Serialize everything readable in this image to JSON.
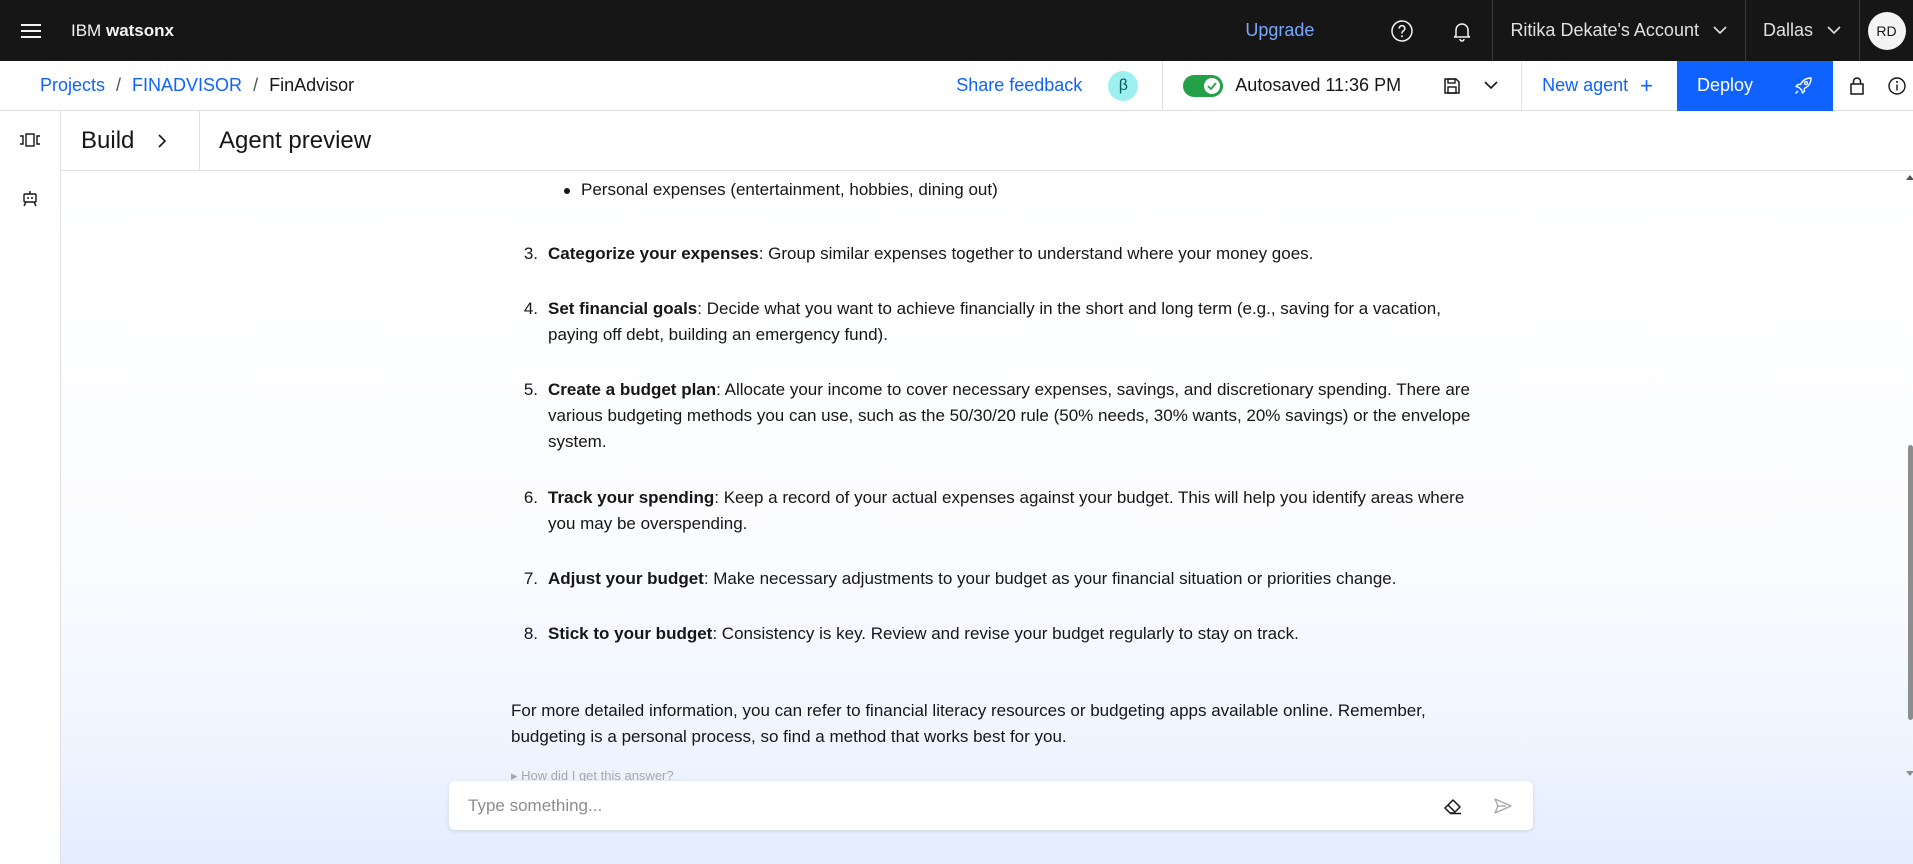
{
  "header": {
    "brand_prefix": "IBM",
    "brand_name": "watsonx",
    "upgrade_label": "Upgrade",
    "account_label": "Ritika Dekate's Account",
    "region_label": "Dallas",
    "avatar_initials": "RD"
  },
  "subbar": {
    "breadcrumb": [
      "Projects",
      "FINADVISOR",
      "FinAdvisor"
    ],
    "breadcrumb_separator": "/",
    "share_feedback": "Share feedback",
    "beta_badge": "β",
    "autosave_on": true,
    "autosaved_text": "Autosaved 11:36 PM",
    "new_agent_label": "New agent",
    "new_agent_plus": "+",
    "deploy_label": "Deploy"
  },
  "panel": {
    "build_label": "Build",
    "title": "Agent preview"
  },
  "chat": {
    "bullet_text": "Personal expenses (entertainment, hobbies, dining out)",
    "items": [
      {
        "num": "3.",
        "bold": "Categorize your expenses",
        "rest": ": Group similar expenses together to understand where your money goes."
      },
      {
        "num": "4.",
        "bold": "Set financial goals",
        "rest": ": Decide what you want to achieve financially in the short and long term (e.g., saving for a vacation, paying off debt, building an emergency fund)."
      },
      {
        "num": "5.",
        "bold": "Create a budget plan",
        "rest": ": Allocate your income to cover necessary expenses, savings, and discretionary spending. There are various budgeting methods you can use, such as the 50/30/20 rule (50% needs, 30% wants, 20% savings) or the envelope system."
      },
      {
        "num": "6.",
        "bold": "Track your spending",
        "rest": ": Keep a record of your actual expenses against your budget. This will help you identify areas where you may be overspending."
      },
      {
        "num": "7.",
        "bold": "Adjust your budget",
        "rest": ": Make necessary adjustments to your budget as your financial situation or priorities change."
      },
      {
        "num": "8.",
        "bold": "Stick to your budget",
        "rest": ": Consistency is key. Review and revise your budget regularly to stay on track."
      }
    ],
    "closing": "For more detailed information, you can refer to financial literacy resources or budgeting apps available online. Remember, budgeting is a personal process, so find a method that works best for you.",
    "how_label": "▸ How did I get this answer?"
  },
  "input": {
    "placeholder": "Type something...",
    "value": ""
  },
  "colors": {
    "header_bg": "#161616",
    "link_blue": "#0f62fe",
    "upgrade_blue": "#78a9ff",
    "toggle_green": "#24a148",
    "beta_bg": "#9ef0f0"
  },
  "icons": [
    "hamburger-icon",
    "help-icon",
    "notification-icon",
    "chevron-down-icon",
    "save-icon",
    "rocket-icon",
    "lock-icon",
    "info-icon",
    "canvas-icon",
    "agent-icon",
    "chevron-right-icon",
    "eraser-icon",
    "send-icon",
    "checkmark-icon"
  ]
}
